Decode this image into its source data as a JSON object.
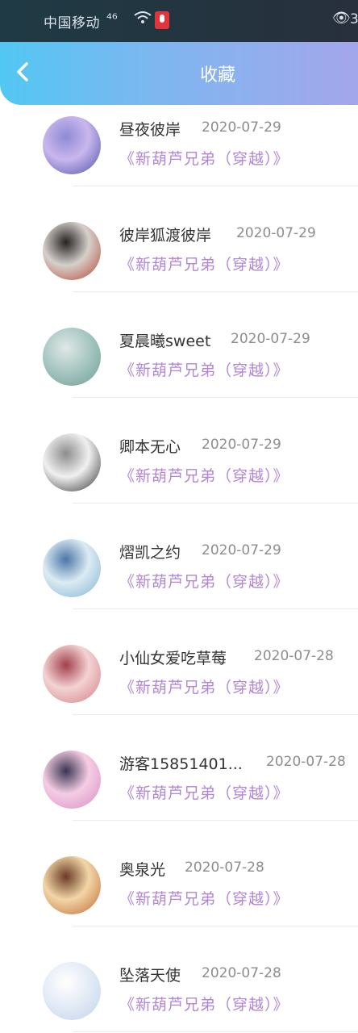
{
  "status_bar": {
    "carrier": "中国移动",
    "signal": "⁴⁶",
    "right_text": "3"
  },
  "header": {
    "back_icon": "chevron-left-icon",
    "title": "收藏"
  },
  "favorites": [
    {
      "name": "昼夜彼岸",
      "date": "2020-07-29",
      "book": "《新葫芦兄弟（穿越）》",
      "avatar_colors": [
        "#c9b7ee",
        "#4c4fa8",
        "#8f8ad6"
      ]
    },
    {
      "name": "彼岸狐渡彼岸",
      "date": "2020-07-29",
      "book": "《新葫芦兄弟（穿越）》",
      "avatar_colors": [
        "#d6d0cb",
        "#b5422f",
        "#262323"
      ]
    },
    {
      "name": "夏晨曦sweet",
      "date": "2020-07-29",
      "book": "《新葫芦兄弟（穿越）》",
      "avatar_colors": [
        "#a9c8c3",
        "#6f9c95",
        "#e0e8e4"
      ]
    },
    {
      "name": "卿本无心",
      "date": "2020-07-29",
      "book": "《新葫芦兄弟（穿越）》",
      "avatar_colors": [
        "#f0f0f0",
        "#2d2d2d",
        "#8c8c8c"
      ]
    },
    {
      "name": "熠凯之约",
      "date": "2020-07-29",
      "book": "《新葫芦兄弟（穿越）》",
      "avatar_colors": [
        "#dcebf3",
        "#7fb2d2",
        "#4b77a8"
      ]
    },
    {
      "name": "小仙女爱吃草莓",
      "date": "2020-07-28",
      "book": "《新葫芦兄弟（穿越）》",
      "avatar_colors": [
        "#f3d3d3",
        "#d27c84",
        "#a3404c"
      ]
    },
    {
      "name": "游客15851401...",
      "date": "2020-07-28",
      "book": "《新葫芦兄弟（穿越）》",
      "avatar_colors": [
        "#f5cde3",
        "#d58bc7",
        "#3a3552"
      ]
    },
    {
      "name": "奥泉光",
      "date": "2020-07-28",
      "book": "《新葫芦兄弟（穿越）》",
      "avatar_colors": [
        "#f2d6a8",
        "#c1652f",
        "#6b3c25"
      ]
    },
    {
      "name": "坠落天使",
      "date": "2020-07-28",
      "book": "《新葫芦兄弟（穿越）》",
      "avatar_colors": [
        "#e4ecf6",
        "#c2d3ea",
        "#ffffff"
      ]
    }
  ]
}
